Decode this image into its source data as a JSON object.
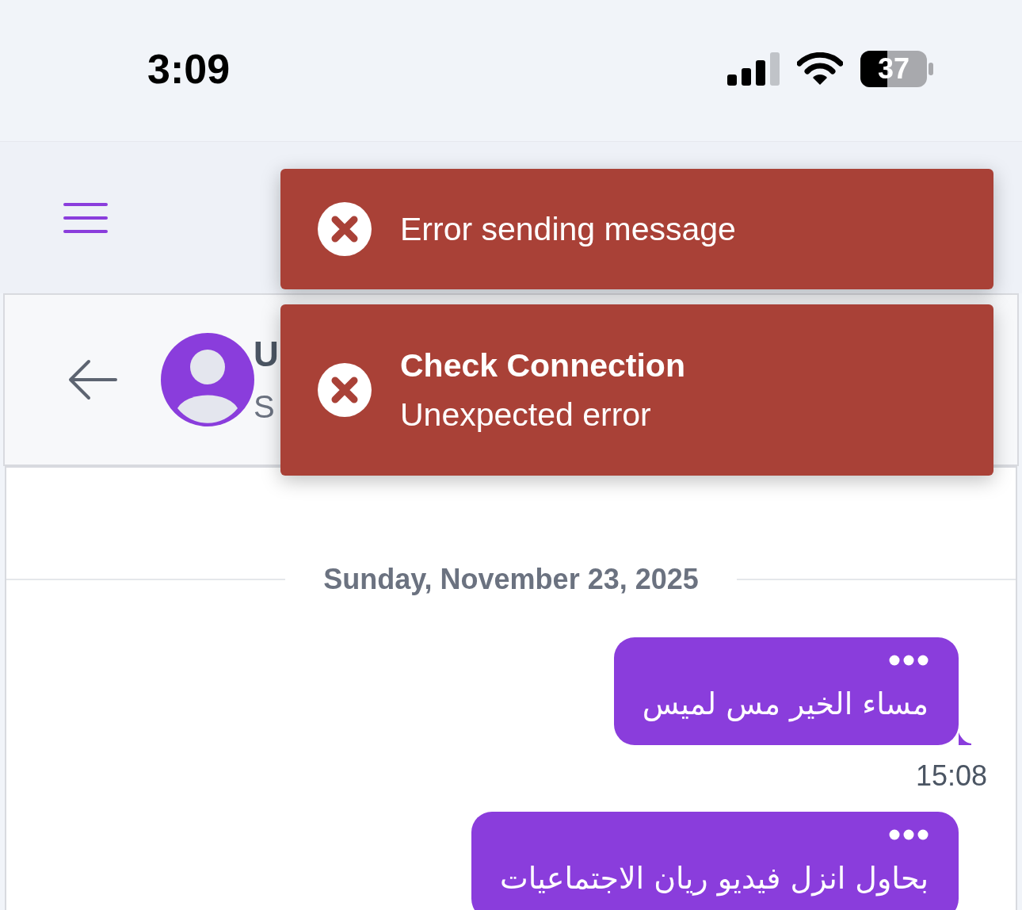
{
  "status_bar": {
    "time": "3:09",
    "battery": "37"
  },
  "toasts": [
    {
      "kind": "error",
      "message": "Error sending message"
    },
    {
      "kind": "error",
      "title": "Check Connection",
      "message": "Unexpected error"
    }
  ],
  "chat_header": {
    "name": "U",
    "subtitle": "S"
  },
  "date_divider": "Sunday, November 23, 2025",
  "messages": [
    {
      "text": "مساء الخير مس لميس",
      "time": "15:08",
      "tail": true
    },
    {
      "text": "بحاول انزل فيديو ريان الاجتماعيات",
      "tail": false
    }
  ]
}
